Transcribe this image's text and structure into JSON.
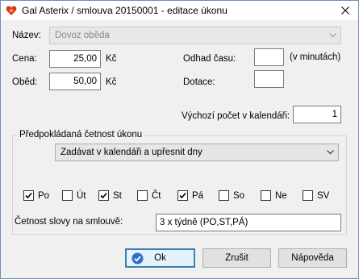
{
  "window": {
    "title": "Gal Asterix / smlouva 20150001 - editace úkonu"
  },
  "form": {
    "nazev": {
      "label": "Název:",
      "value": "Dovoz oběda"
    },
    "cena": {
      "label": "Cena:",
      "value": "25,00",
      "unit": "Kč"
    },
    "obed": {
      "label": "Oběd:",
      "value": "50,00",
      "unit": "Kč"
    },
    "odhad": {
      "label": "Odhad času:",
      "value": "",
      "unit": "(v minutách)"
    },
    "dotace": {
      "label": "Dotace:",
      "value": ""
    },
    "vychozi": {
      "label": "Výchozí počet v kalendáři:",
      "value": "1"
    }
  },
  "group": {
    "title": "Předpokládaná četnost úkonu",
    "select_value": "Zadávat v kalendáři a upřesnit dny",
    "days": [
      {
        "label": "Po",
        "checked": true
      },
      {
        "label": "Út",
        "checked": false
      },
      {
        "label": "St",
        "checked": true
      },
      {
        "label": "Čt",
        "checked": false
      },
      {
        "label": "Pá",
        "checked": true
      },
      {
        "label": "So",
        "checked": false
      },
      {
        "label": "Ne",
        "checked": false
      },
      {
        "label": "SV",
        "checked": false
      }
    ],
    "cetnost": {
      "label": "Četnost slovy na smlouvě:",
      "value": "3 x týdně (PO,ST,PÁ)"
    }
  },
  "buttons": {
    "ok": "Ok",
    "cancel": "Zrušit",
    "help": "Nápověda"
  },
  "colors": {
    "accent": "#3c7fb1",
    "icon_red": "#d9342b",
    "icon_blue": "#2a6fc9"
  }
}
